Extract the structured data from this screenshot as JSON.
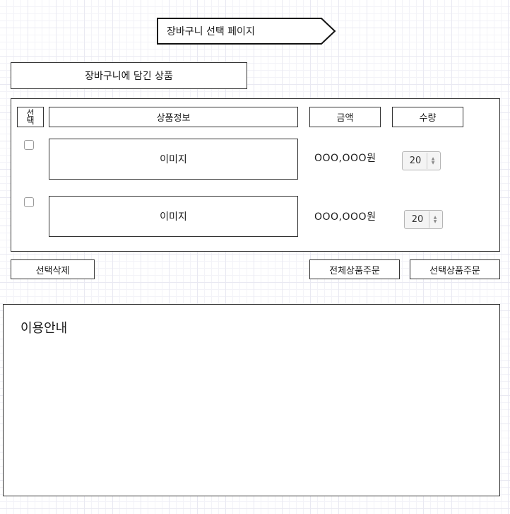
{
  "page_title": "장바구니 선택 페이지",
  "cart_header": "장바구니에 담긴 상품",
  "table_headers": {
    "select_line1": "선",
    "select_line2": "택",
    "product_info": "상품정보",
    "price": "금액",
    "quantity": "수량"
  },
  "rows": [
    {
      "image_label": "이미지",
      "price": "OOO,OOO원",
      "quantity": "20",
      "checked": false
    },
    {
      "image_label": "이미지",
      "price": "OOO,OOO원",
      "quantity": "20",
      "checked": false
    }
  ],
  "buttons": {
    "delete_selected": "선택삭제",
    "order_all": "전체상품주문",
    "order_selected": "선택상품주문"
  },
  "guide": {
    "title": "이용안내"
  }
}
